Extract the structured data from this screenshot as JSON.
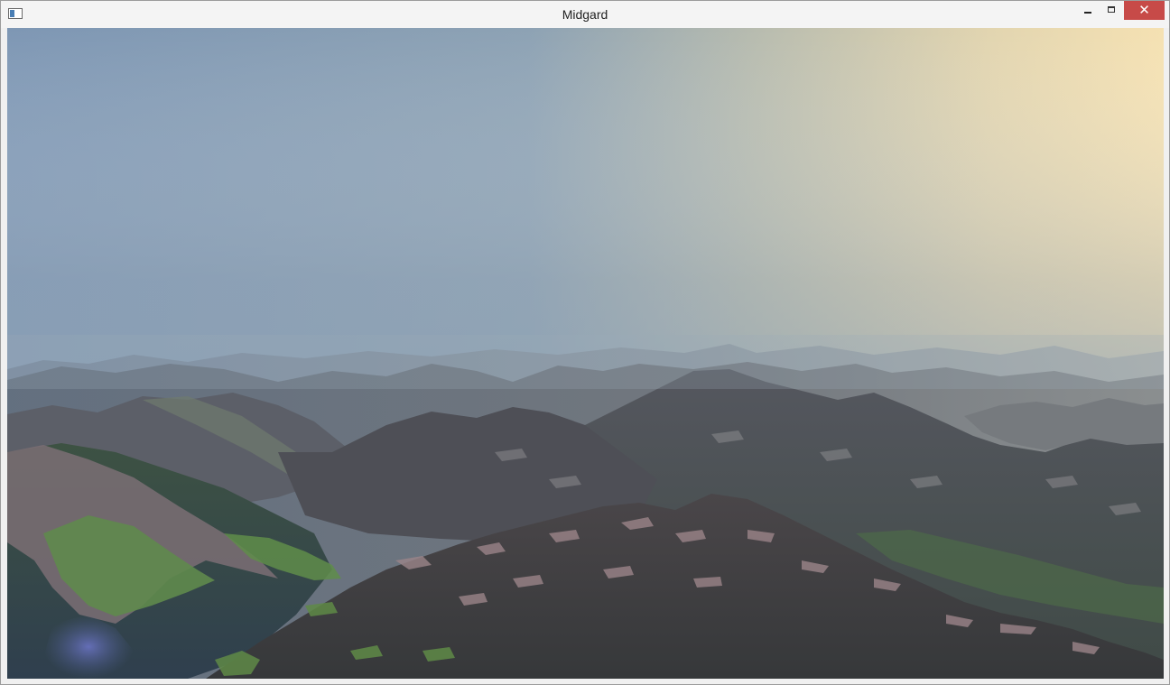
{
  "window": {
    "title": "Midgard",
    "close_glyph": "✕",
    "icons": {
      "app": "app-window-icon",
      "minimize": "minimize-icon",
      "maximize": "maximize-icon",
      "close": "close-icon"
    }
  },
  "scene": {
    "description_colors": {
      "sky_left": "#7f97b3",
      "sky_sun": "#f3e1b4",
      "haze": "#8ea2b3",
      "rock_dark": "#47474d",
      "grass": "#5b8a47"
    }
  }
}
